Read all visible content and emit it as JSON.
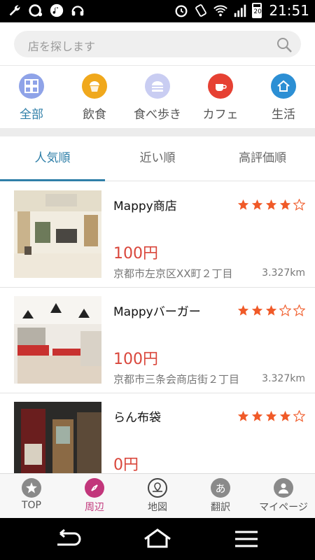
{
  "status_bar": {
    "time": "21:51",
    "battery": "20"
  },
  "search": {
    "placeholder": "店を探します"
  },
  "categories": [
    {
      "label": "全部",
      "icon": "grid-icon",
      "color": "#8fa3e8",
      "active": true
    },
    {
      "label": "飲食",
      "icon": "cupcake-icon",
      "color": "#f0a81c"
    },
    {
      "label": "食べ歩き",
      "icon": "burger-icon",
      "color": "#c9cdf2"
    },
    {
      "label": "カフェ",
      "icon": "coffee-cup-icon",
      "color": "#e64133"
    },
    {
      "label": "生活",
      "icon": "home-icon",
      "color": "#2c8fd4"
    }
  ],
  "sort_tabs": [
    {
      "label": "人気順",
      "active": true
    },
    {
      "label": "近い順"
    },
    {
      "label": "高評価順"
    }
  ],
  "shops": [
    {
      "name": "Mappy商店",
      "rating": 4,
      "price": "100円",
      "address": "京都市左京区XX町２丁目",
      "distance": "3.327km"
    },
    {
      "name": "Mappyバーガー",
      "rating": 3,
      "price": "100円",
      "address": "京都市三条会商店街２丁目",
      "distance": "3.327km"
    },
    {
      "name": "らん布袋",
      "rating": 4,
      "price": "0円",
      "address": "",
      "distance": ""
    }
  ],
  "bottom_nav": [
    {
      "label": "TOP",
      "icon": "flower-icon"
    },
    {
      "label": "周辺",
      "icon": "compass-icon",
      "active": true
    },
    {
      "label": "地図",
      "icon": "map-pin-icon"
    },
    {
      "label": "翻訳",
      "icon": "translate-icon"
    },
    {
      "label": "マイページ",
      "icon": "user-icon"
    }
  ],
  "colors": {
    "accent": "#2f7fa8",
    "price": "#d9463b",
    "star": "#f05a28",
    "active_nav": "#c2367b"
  }
}
